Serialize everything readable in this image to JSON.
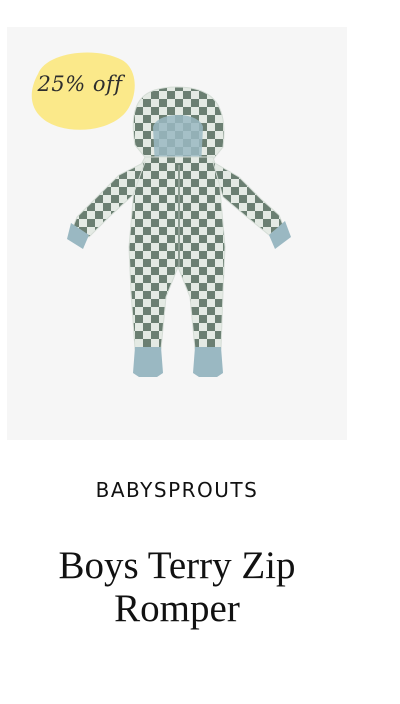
{
  "product": {
    "discount_badge": "25% off",
    "badge_color": "#fbe98a",
    "brand": "BABYSPROUTS",
    "title": "Boys Terry Zip Romper",
    "image_colors": {
      "check_dark": "#6b7f72",
      "check_light": "#e4eae4",
      "cuff": "#9ab8c2"
    }
  }
}
